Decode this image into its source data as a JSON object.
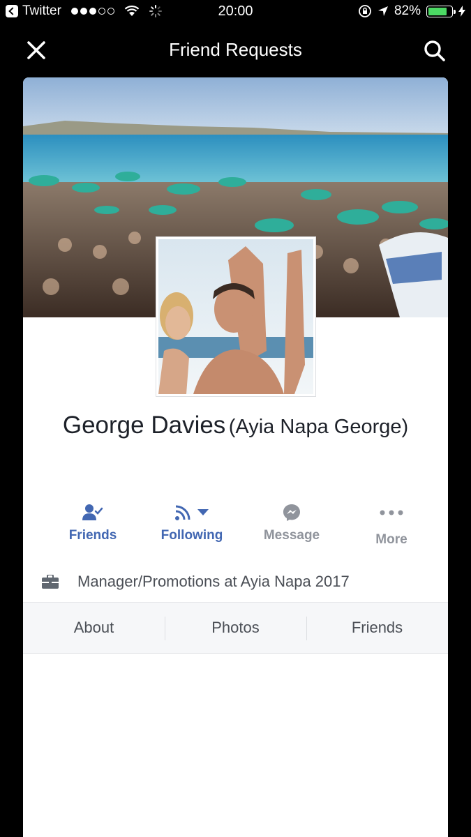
{
  "status_bar": {
    "back_app": "Twitter",
    "time": "20:00",
    "battery": "82%",
    "battery_level": 0.82,
    "signal_bars_filled": 3,
    "signal_bars_total": 5
  },
  "nav": {
    "title": "Friend Requests",
    "close_icon": "close-icon",
    "search_icon": "search-icon"
  },
  "profile": {
    "name": "George Davies",
    "alternate_name": "(Ayia Napa George)",
    "work": "Manager/Promotions at Ayia Napa 2017"
  },
  "actions": [
    {
      "label": "Friends",
      "icon": "friend-check-icon"
    },
    {
      "label": "Following",
      "icon": "rss-icon"
    },
    {
      "label": "Message",
      "icon": "messenger-icon"
    },
    {
      "label": "More",
      "icon": "more-dots-icon"
    }
  ],
  "tabs": [
    {
      "label": "About"
    },
    {
      "label": "Photos"
    },
    {
      "label": "Friends"
    }
  ],
  "colors": {
    "facebook_blue": "#4267b2",
    "gray_text": "#90949c",
    "battery_green": "#4cd964"
  }
}
